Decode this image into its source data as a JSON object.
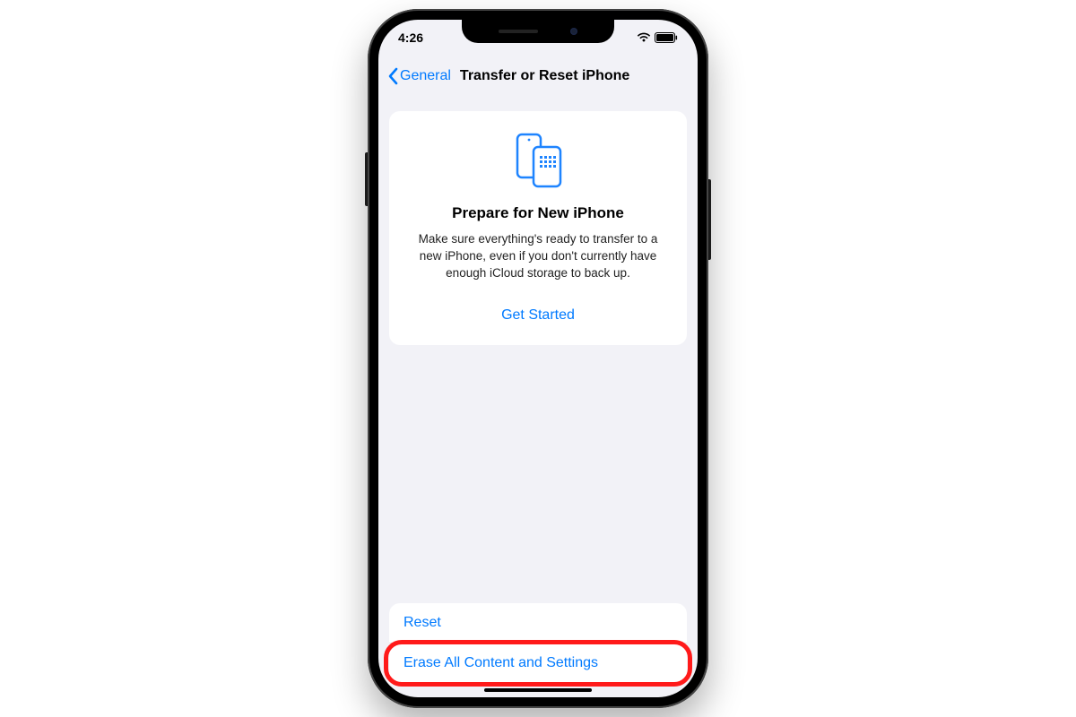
{
  "status": {
    "time": "4:26"
  },
  "nav": {
    "back": "General",
    "title": "Transfer or Reset iPhone"
  },
  "card": {
    "title": "Prepare for New iPhone",
    "body": "Make sure everything's ready to transfer to a new iPhone, even if you don't currently have enough iCloud storage to back up.",
    "cta": "Get Started"
  },
  "actions": {
    "reset": "Reset",
    "erase": "Erase All Content and Settings"
  },
  "colors": {
    "accent": "#007aff",
    "highlight": "#ff1a1a"
  }
}
